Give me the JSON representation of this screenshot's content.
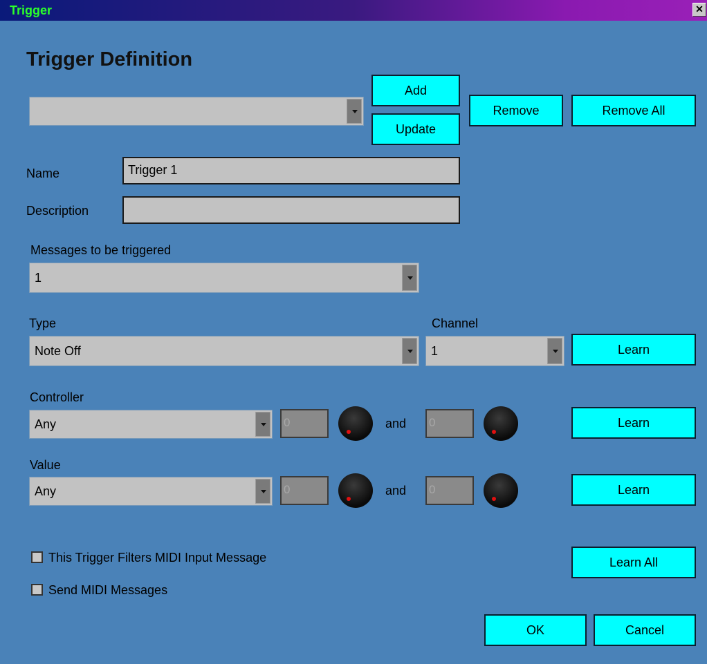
{
  "window": {
    "title": "Trigger",
    "close_glyph": "✕"
  },
  "heading": "Trigger Definition",
  "trigger_select": {
    "value": ""
  },
  "buttons": {
    "add": "Add",
    "update": "Update",
    "remove": "Remove",
    "remove_all": "Remove All",
    "learn_type": "Learn",
    "learn_controller": "Learn",
    "learn_value": "Learn",
    "learn_all": "Learn All",
    "ok": "OK",
    "cancel": "Cancel"
  },
  "name": {
    "label": "Name",
    "value": "Trigger 1"
  },
  "description": {
    "label": "Description",
    "value": ""
  },
  "messages": {
    "label": "Messages to be triggered",
    "value": "1"
  },
  "type": {
    "label": "Type",
    "value": "Note Off"
  },
  "channel": {
    "label": "Channel",
    "value": "1"
  },
  "controller": {
    "label": "Controller",
    "select": "Any",
    "min": "0",
    "and": "and",
    "max": "0"
  },
  "value": {
    "label": "Value",
    "select": "Any",
    "min": "0",
    "and": "and",
    "max": "0"
  },
  "checkboxes": {
    "filter": {
      "label": "This Trigger Filters MIDI Input Message",
      "checked": false
    },
    "send": {
      "label": "Send MIDI Messages",
      "checked": false
    }
  },
  "colors": {
    "background": "#4a82b8",
    "button": "#00ffff",
    "title_text": "#2bff2b"
  }
}
